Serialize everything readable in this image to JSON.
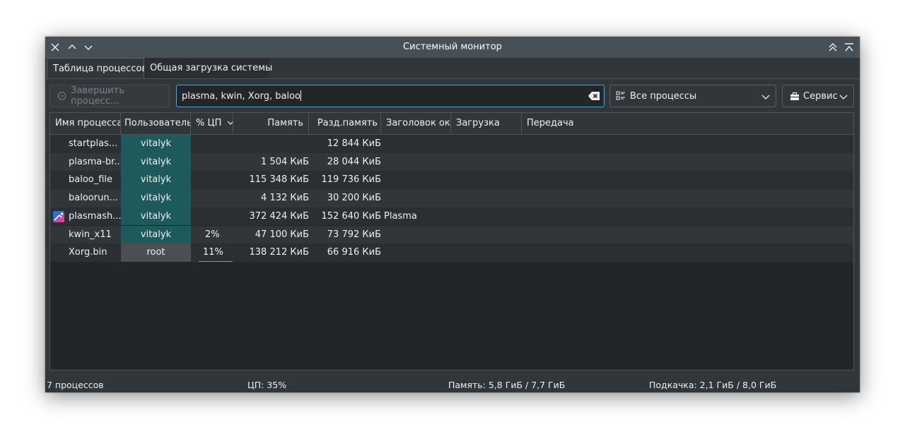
{
  "window": {
    "title": "Системный монитор"
  },
  "tabs": [
    {
      "label": "Таблица процессов",
      "active": true
    },
    {
      "label": "Общая загрузка системы",
      "active": false
    }
  ],
  "toolbar": {
    "kill_label": "Завершить процесс...",
    "search_value": "plasma, kwin, Xorg, baloo",
    "filter_value": "Все процессы",
    "tools_label": "Сервис"
  },
  "table": {
    "columns": [
      "Имя процесса",
      "Пользователь",
      "% ЦП",
      "Память",
      "Разд.память",
      "Заголовок окн",
      "Загрузка",
      "Передача"
    ],
    "rows": [
      {
        "name": "startplas...",
        "user": "vitalyk",
        "cpu": "",
        "mem": "",
        "shared": "12 844 КиБ",
        "title": "",
        "icon": ""
      },
      {
        "name": "plasma-br...",
        "user": "vitalyk",
        "cpu": "",
        "mem": "1 504 КиБ",
        "shared": "28 044 КиБ",
        "title": "",
        "icon": ""
      },
      {
        "name": "baloo_file",
        "user": "vitalyk",
        "cpu": "",
        "mem": "115 348 КиБ",
        "shared": "119 736 КиБ",
        "title": "",
        "icon": ""
      },
      {
        "name": "baloorun...",
        "user": "vitalyk",
        "cpu": "",
        "mem": "4 132 КиБ",
        "shared": "30 200 КиБ",
        "title": "",
        "icon": ""
      },
      {
        "name": "plasmash...",
        "user": "vitalyk",
        "cpu": "",
        "mem": "372 424 КиБ",
        "shared": "152 640 КиБ",
        "title": "Plasma",
        "icon": "plasma-icon"
      },
      {
        "name": "kwin_x11",
        "user": "vitalyk",
        "cpu": "2%",
        "mem": "47 100 КиБ",
        "shared": "73 792 КиБ",
        "title": "",
        "icon": ""
      },
      {
        "name": "Xorg.bin",
        "user": "root",
        "cpu": "11%",
        "mem": "138 212 КиБ",
        "shared": "66 916 КиБ",
        "title": "",
        "icon": ""
      }
    ]
  },
  "status": {
    "processes": "7 процессов",
    "cpu": "ЦП: 35%",
    "memory": "Память: 5,8 ГиБ / 7,7 ГиБ",
    "swap": "Подкачка: 2,1 ГиБ / 8,0 ГиБ"
  },
  "colors": {
    "window_bg": "#31363b",
    "accent": "#3daee9",
    "user_highlight": "#1e5a5c"
  }
}
